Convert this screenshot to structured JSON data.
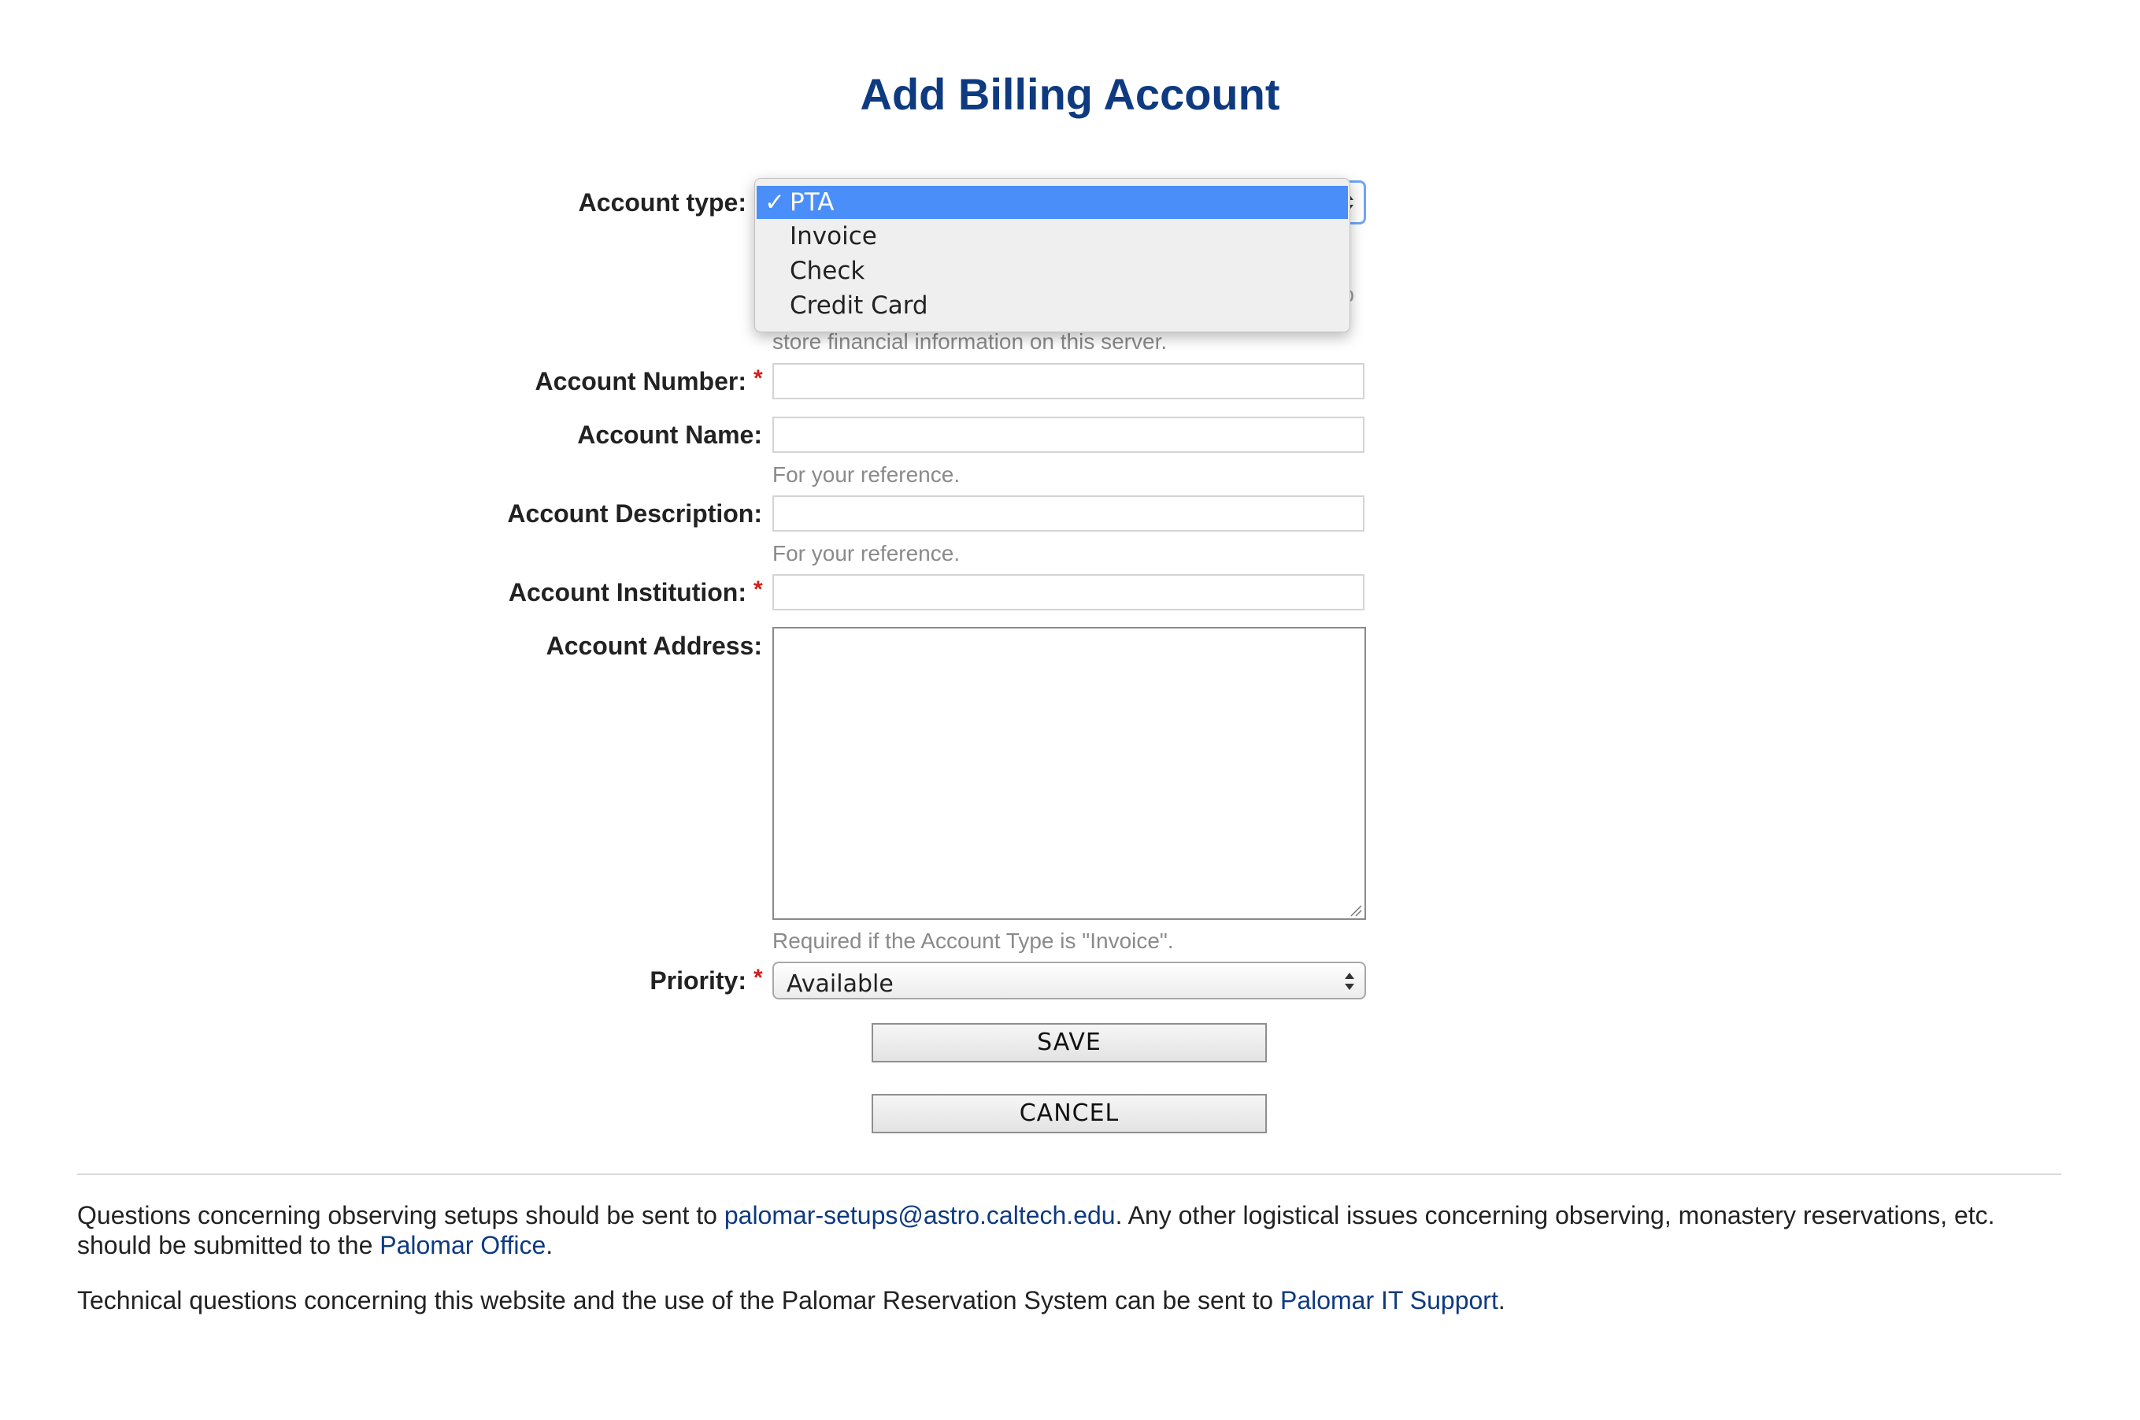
{
  "page": {
    "title": "Add Billing Account"
  },
  "form": {
    "account_type": {
      "label": "Account type:",
      "options": [
        "PTA",
        "Invoice",
        "Check",
        "Credit Card"
      ],
      "selected": "PTA",
      "check_mark": "✓"
    },
    "account_type_help_partial": "store financial information on this server.",
    "account_number": {
      "label": "Account Number:",
      "required_mark": "*",
      "value": ""
    },
    "account_name": {
      "label": "Account Name:",
      "value": "",
      "help": "For your reference."
    },
    "account_description": {
      "label": "Account Description:",
      "value": "",
      "help": "For your reference."
    },
    "account_institution": {
      "label": "Account Institution:",
      "required_mark": "*",
      "value": ""
    },
    "account_address": {
      "label": "Account Address:",
      "value": "",
      "help": "Required if the Account Type is \"Invoice\"."
    },
    "priority": {
      "label": "Priority:",
      "required_mark": "*",
      "selected": "Available"
    },
    "save_label": "SAVE",
    "cancel_label": "CANCEL"
  },
  "footer": {
    "p1_before": "Questions concerning observing setups should be sent to ",
    "p1_link1": "palomar-setups@astro.caltech.edu",
    "p1_middle": ". Any other logistical issues concerning observing, monastery reservations, etc. should be submitted to the ",
    "p1_link2": "Palomar Office",
    "p1_end": ".",
    "p2_before": "Technical questions concerning this website and the use of the Palomar Reservation System can be sent to ",
    "p2_link": "Palomar IT Support",
    "p2_end": "."
  },
  "colors": {
    "title": "#0e3a80",
    "link": "#0e3a80",
    "required": "#d0201a",
    "selection": "#4a8ef9",
    "focus_ring": "#6ea5f5"
  }
}
